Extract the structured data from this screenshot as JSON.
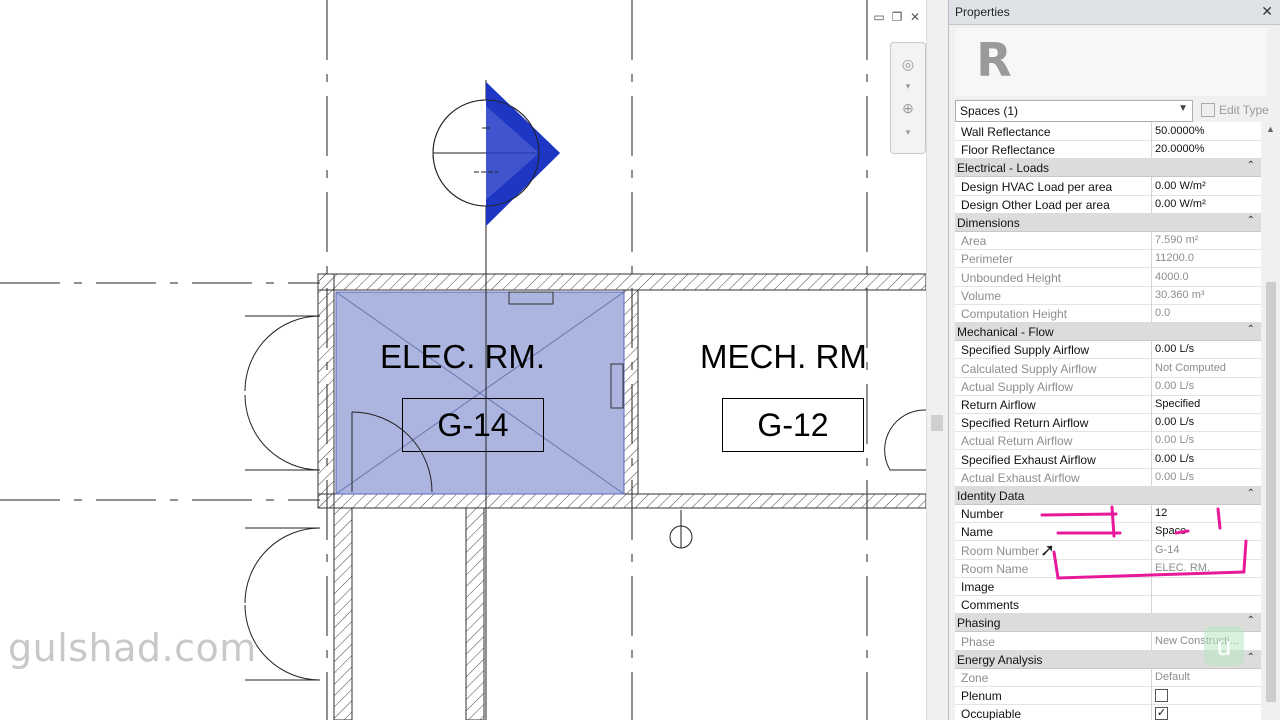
{
  "canvas": {
    "rooms": [
      {
        "name": "ELEC. RM.",
        "number": "G-14"
      },
      {
        "name": "MECH. RM",
        "number": "G-12"
      }
    ],
    "colors": {
      "selection": "#9ea8da",
      "marker": "#1f36c4",
      "line": "#222222"
    },
    "watermark": "gulshad.com"
  },
  "view_controls": {
    "minimize_icon": "minimize-icon",
    "restore_icon": "restore-icon",
    "close_icon": "close-icon"
  },
  "properties": {
    "title": "Properties",
    "close_glyph": "✕",
    "logo_letter": "R",
    "type_selector": "Spaces (1)",
    "edit_type": "Edit Type",
    "rows": [
      {
        "kind": "param",
        "label": "Wall Reflectance",
        "value": "50.0000%",
        "ro": false
      },
      {
        "kind": "param",
        "label": "Floor Reflectance",
        "value": "20.0000%",
        "ro": false
      },
      {
        "kind": "group",
        "label": "Electrical - Loads"
      },
      {
        "kind": "param",
        "label": "Design HVAC Load per area",
        "value": "0.00 W/m²",
        "ro": false
      },
      {
        "kind": "param",
        "label": "Design Other Load per area",
        "value": "0.00 W/m²",
        "ro": false
      },
      {
        "kind": "group",
        "label": "Dimensions"
      },
      {
        "kind": "param",
        "label": "Area",
        "value": "7.590 m²",
        "ro": true
      },
      {
        "kind": "param",
        "label": "Perimeter",
        "value": "11200.0",
        "ro": true
      },
      {
        "kind": "param",
        "label": "Unbounded Height",
        "value": "4000.0",
        "ro": true
      },
      {
        "kind": "param",
        "label": "Volume",
        "value": "30.360 m³",
        "ro": true
      },
      {
        "kind": "param",
        "label": "Computation Height",
        "value": "0.0",
        "ro": true
      },
      {
        "kind": "group",
        "label": "Mechanical - Flow"
      },
      {
        "kind": "param",
        "label": "Specified Supply Airflow",
        "value": "0.00 L/s",
        "ro": false
      },
      {
        "kind": "param",
        "label": "Calculated Supply Airflow",
        "value": "Not Computed",
        "ro": true
      },
      {
        "kind": "param",
        "label": "Actual Supply Airflow",
        "value": "0.00 L/s",
        "ro": true
      },
      {
        "kind": "param",
        "label": "Return Airflow",
        "value": "Specified",
        "ro": false
      },
      {
        "kind": "param",
        "label": "Specified Return Airflow",
        "value": "0.00 L/s",
        "ro": false
      },
      {
        "kind": "param",
        "label": "Actual Return Airflow",
        "value": "0.00 L/s",
        "ro": true
      },
      {
        "kind": "param",
        "label": "Specified Exhaust Airflow",
        "value": "0.00 L/s",
        "ro": false
      },
      {
        "kind": "param",
        "label": "Actual Exhaust Airflow",
        "value": "0.00 L/s",
        "ro": true
      },
      {
        "kind": "group",
        "label": "Identity Data"
      },
      {
        "kind": "param",
        "label": "Number",
        "value": "12",
        "ro": false
      },
      {
        "kind": "param",
        "label": "Name",
        "value": "Space",
        "ro": false
      },
      {
        "kind": "param",
        "label": "Room Number",
        "value": "G-14",
        "ro": true
      },
      {
        "kind": "param",
        "label": "Room Name",
        "value": "ELEC. RM.",
        "ro": true
      },
      {
        "kind": "param",
        "label": "Image",
        "value": "",
        "ro": false
      },
      {
        "kind": "param",
        "label": "Comments",
        "value": "",
        "ro": false
      },
      {
        "kind": "group",
        "label": "Phasing"
      },
      {
        "kind": "param",
        "label": "Phase",
        "value": "New Constructi...",
        "ro": true
      },
      {
        "kind": "group",
        "label": "Energy Analysis"
      },
      {
        "kind": "param",
        "label": "Zone",
        "value": "Default",
        "ro": true
      },
      {
        "kind": "check",
        "label": "Plenum",
        "checked": false
      },
      {
        "kind": "check",
        "label": "Occupiable",
        "checked": true
      }
    ]
  }
}
